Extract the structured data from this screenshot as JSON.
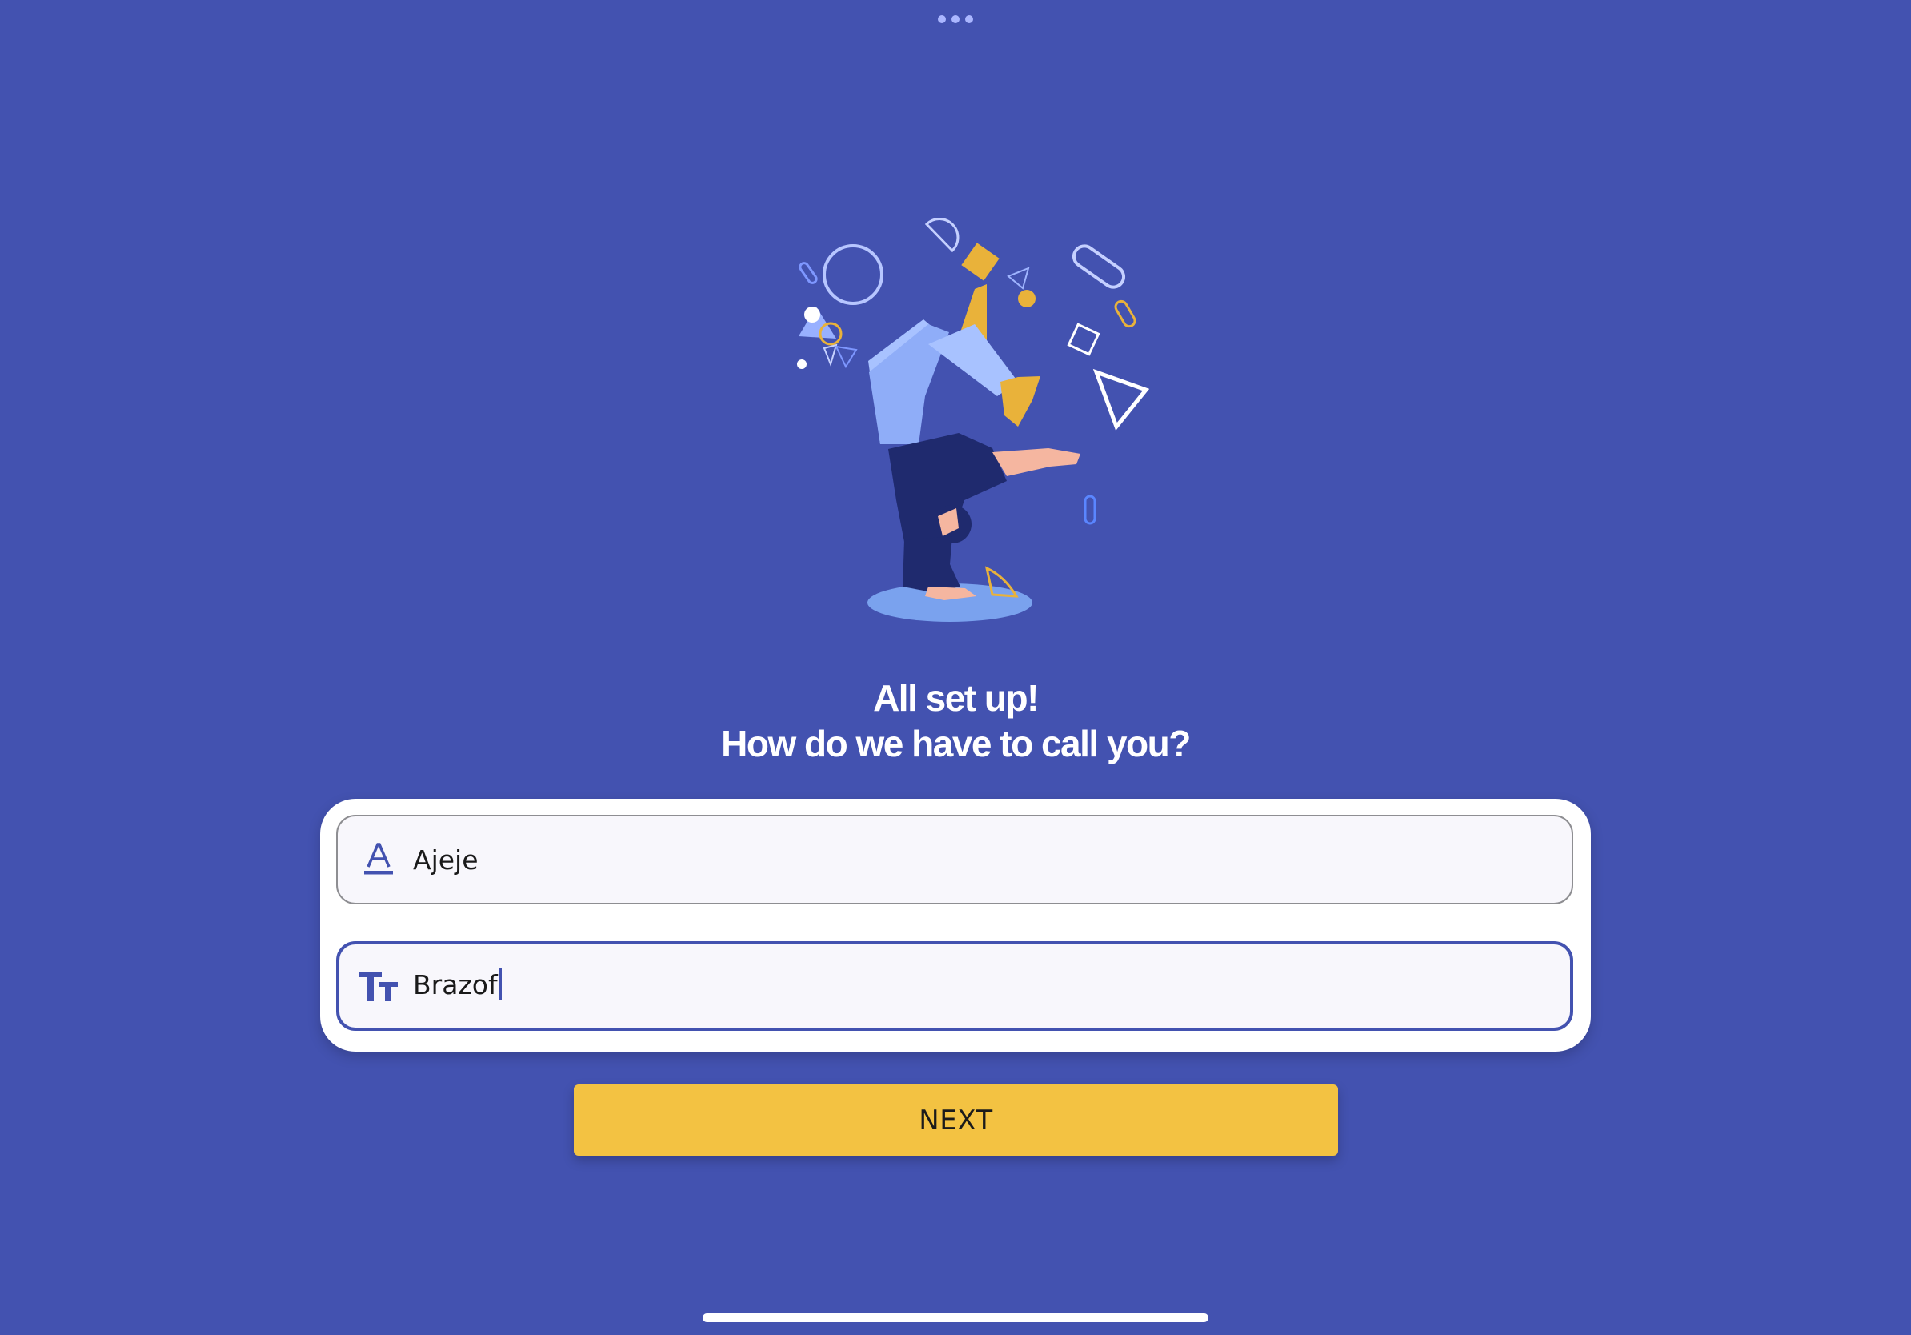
{
  "status_bar": {
    "multitask_icon": "more-dots-icon"
  },
  "illustration": {
    "icon": "handstand-person-illustration"
  },
  "heading": {
    "line1": "All set up!",
    "line2": "How do we have to call you?"
  },
  "form": {
    "first_name": {
      "icon": "letter-a-underline-icon",
      "value": "Ajeje"
    },
    "last_name": {
      "icon": "text-size-icon",
      "value": "Brazof",
      "focused": true
    }
  },
  "next_button": {
    "label": "NEXT"
  },
  "colors": {
    "background": "#4352b0",
    "accent": "#f3c242",
    "card": "#ffffff",
    "field_bg": "#f8f7fc",
    "focus_border": "#4352b0"
  }
}
